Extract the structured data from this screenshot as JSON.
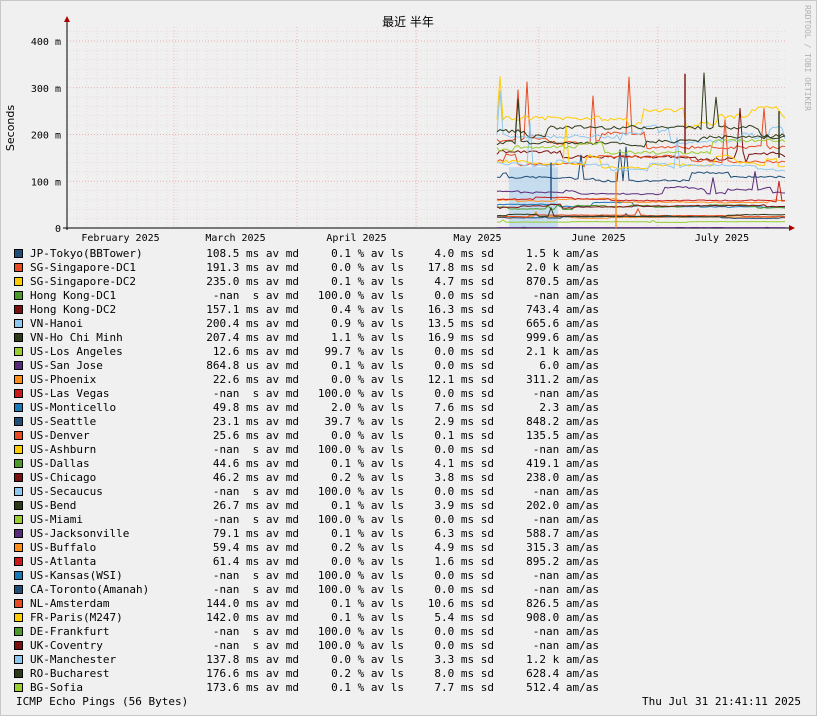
{
  "chart_data": {
    "type": "line",
    "title": "最近 半年",
    "ylabel": "Seconds",
    "watermark": "RRDTOOL / TOBI OETIKER",
    "y_ticks": [
      "0",
      "100 m",
      "200 m",
      "300 m",
      "400 m"
    ],
    "y_tick_values": [
      0,
      0.1,
      0.2,
      0.3,
      0.4
    ],
    "ylim": [
      0,
      0.43
    ],
    "x_ticks": [
      "February 2025",
      "March 2025",
      "April 2025",
      "May 2025",
      "June 2025",
      "July 2025"
    ],
    "grid": true,
    "legend_position": "bottom",
    "data_start_month": "May 2025",
    "series": [
      {
        "name": "JP-Tokyo(BBTower)",
        "color": "#1f4e79",
        "avg": "108.5 ms",
        "loss": "0.1 %",
        "sd": "4.0 ms",
        "amas": "1.5 k",
        "level": 0.1085
      },
      {
        "name": "SG-Singapore-DC1",
        "color": "#e84c22",
        "avg": "191.3 ms",
        "loss": "0.0 %",
        "sd": "17.8 ms",
        "amas": "2.0 k",
        "level": 0.1913
      },
      {
        "name": "SG-Singapore-DC2",
        "color": "#ffcc00",
        "avg": "235.0 ms",
        "loss": "0.1 %",
        "sd": "4.7 ms",
        "amas": "870.5",
        "level": 0.235
      },
      {
        "name": "Hong Kong-DC1",
        "color": "#4c9a2a",
        "avg": "-nan  s",
        "loss": "100.0 %",
        "sd": "0.0 ms",
        "amas": "-nan",
        "level": null
      },
      {
        "name": "Hong Kong-DC2",
        "color": "#7a1010",
        "avg": "157.1 ms",
        "loss": "0.4 %",
        "sd": "16.3 ms",
        "amas": "743.4",
        "level": 0.1571
      },
      {
        "name": "VN-Hanoi",
        "color": "#8fc8ef",
        "avg": "200.4 ms",
        "loss": "0.9 %",
        "sd": "13.5 ms",
        "amas": "665.6",
        "level": 0.2004
      },
      {
        "name": "VN-Ho Chi Minh",
        "color": "#2d3a1a",
        "avg": "207.4 ms",
        "loss": "1.1 %",
        "sd": "16.9 ms",
        "amas": "999.6",
        "level": 0.2074
      },
      {
        "name": "US-Los Angeles",
        "color": "#9acd32",
        "avg": "12.6 ms",
        "loss": "99.7 %",
        "sd": "0.0 ms",
        "amas": "2.1 k",
        "level": 0.0126
      },
      {
        "name": "US-San Jose",
        "color": "#5a2a7a",
        "avg": "864.8 us",
        "loss": "0.1 %",
        "sd": "0.0 ms",
        "amas": "6.0",
        "level": 0.0009
      },
      {
        "name": "US-Phoenix",
        "color": "#ff8c1a",
        "avg": "22.6 ms",
        "loss": "0.0 %",
        "sd": "12.1 ms",
        "amas": "311.2",
        "level": 0.0226
      },
      {
        "name": "US-Las Vegas",
        "color": "#cc1a1a",
        "avg": "-nan  s",
        "loss": "100.0 %",
        "sd": "0.0 ms",
        "amas": "-nan",
        "level": null
      },
      {
        "name": "US-Monticello",
        "color": "#1a7ab8",
        "avg": "49.8 ms",
        "loss": "2.0 %",
        "sd": "7.6 ms",
        "amas": "2.3",
        "level": 0.0498
      },
      {
        "name": "US-Seattle",
        "color": "#1f4e79",
        "avg": "23.1 ms",
        "loss": "39.7 %",
        "sd": "2.9 ms",
        "amas": "848.2",
        "level": 0.0231
      },
      {
        "name": "US-Denver",
        "color": "#e84c22",
        "avg": "25.6 ms",
        "loss": "0.0 %",
        "sd": "0.1 ms",
        "amas": "135.5",
        "level": 0.0256
      },
      {
        "name": "US-Ashburn",
        "color": "#ffcc00",
        "avg": "-nan  s",
        "loss": "100.0 %",
        "sd": "0.0 ms",
        "amas": "-nan",
        "level": null
      },
      {
        "name": "US-Dallas",
        "color": "#4c9a2a",
        "avg": "44.6 ms",
        "loss": "0.1 %",
        "sd": "4.1 ms",
        "amas": "419.1",
        "level": 0.0446
      },
      {
        "name": "US-Chicago",
        "color": "#7a1010",
        "avg": "46.2 ms",
        "loss": "0.2 %",
        "sd": "3.8 ms",
        "amas": "238.0",
        "level": 0.0462
      },
      {
        "name": "US-Secaucus",
        "color": "#8fc8ef",
        "avg": "-nan  s",
        "loss": "100.0 %",
        "sd": "0.0 ms",
        "amas": "-nan",
        "level": null
      },
      {
        "name": "US-Bend",
        "color": "#2d3a1a",
        "avg": "26.7 ms",
        "loss": "0.1 %",
        "sd": "3.9 ms",
        "amas": "202.0",
        "level": 0.0267
      },
      {
        "name": "US-Miami",
        "color": "#9acd32",
        "avg": "-nan  s",
        "loss": "100.0 %",
        "sd": "0.0 ms",
        "amas": "-nan",
        "level": null
      },
      {
        "name": "US-Jacksonville",
        "color": "#5a2a7a",
        "avg": "79.1 ms",
        "loss": "0.1 %",
        "sd": "6.3 ms",
        "amas": "588.7",
        "level": 0.0791
      },
      {
        "name": "US-Buffalo",
        "color": "#ff8c1a",
        "avg": "59.4 ms",
        "loss": "0.2 %",
        "sd": "4.9 ms",
        "amas": "315.3",
        "level": 0.0594
      },
      {
        "name": "US-Atlanta",
        "color": "#cc1a1a",
        "avg": "61.4 ms",
        "loss": "0.0 %",
        "sd": "1.6 ms",
        "amas": "895.2",
        "level": 0.0614
      },
      {
        "name": "US-Kansas(WSI)",
        "color": "#1a7ab8",
        "avg": "-nan  s",
        "loss": "100.0 %",
        "sd": "0.0 ms",
        "amas": "-nan",
        "level": null
      },
      {
        "name": "CA-Toronto(Amanah)",
        "color": "#1f4e79",
        "avg": "-nan  s",
        "loss": "100.0 %",
        "sd": "0.0 ms",
        "amas": "-nan",
        "level": null
      },
      {
        "name": "NL-Amsterdam",
        "color": "#e84c22",
        "avg": "144.0 ms",
        "loss": "0.1 %",
        "sd": "10.6 ms",
        "amas": "826.5",
        "level": 0.144
      },
      {
        "name": "FR-Paris(M247)",
        "color": "#ffcc00",
        "avg": "142.0 ms",
        "loss": "0.1 %",
        "sd": "5.4 ms",
        "amas": "908.0",
        "level": 0.142
      },
      {
        "name": "DE-Frankfurt",
        "color": "#4c9a2a",
        "avg": "-nan  s",
        "loss": "100.0 %",
        "sd": "0.0 ms",
        "amas": "-nan",
        "level": null
      },
      {
        "name": "UK-Coventry",
        "color": "#7a1010",
        "avg": "-nan  s",
        "loss": "100.0 %",
        "sd": "0.0 ms",
        "amas": "-nan",
        "level": null
      },
      {
        "name": "UK-Manchester",
        "color": "#8fc8ef",
        "avg": "137.8 ms",
        "loss": "0.0 %",
        "sd": "3.3 ms",
        "amas": "1.2 k",
        "level": 0.1378
      },
      {
        "name": "RO-Bucharest",
        "color": "#2d3a1a",
        "avg": "176.6 ms",
        "loss": "0.2 %",
        "sd": "8.0 ms",
        "amas": "628.4",
        "level": 0.1766
      },
      {
        "name": "BG-Sofia",
        "color": "#9acd32",
        "avg": "173.6 ms",
        "loss": "0.1 %",
        "sd": "7.7 ms",
        "amas": "512.4",
        "level": 0.1736
      }
    ],
    "units": {
      "avg": "av md",
      "loss": "av ls",
      "sd": "sd",
      "amas": "am/as"
    }
  },
  "footer": {
    "left": "ICMP Echo Pings (56 Bytes)",
    "right": "Thu Jul 31 21:41:11 2025"
  }
}
